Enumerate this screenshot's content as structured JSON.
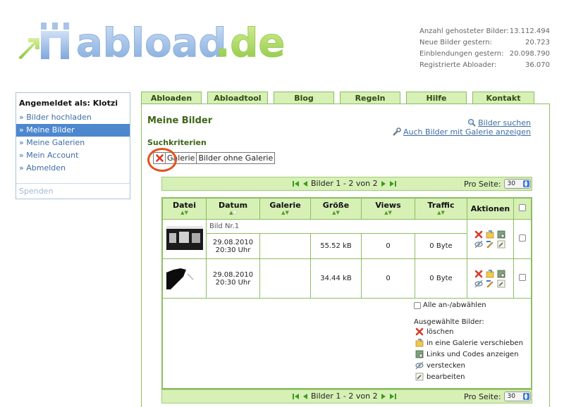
{
  "logo": {
    "text": "abload.de"
  },
  "stats": [
    {
      "label": "Anzahl gehosteter Bilder:",
      "value": "13.112.494"
    },
    {
      "label": "Neue Bilder gestern:",
      "value": "20.723"
    },
    {
      "label": "Einblendungen gestern:",
      "value": "20.098.790"
    },
    {
      "label": "Registrierte Abloader:",
      "value": "36.070"
    }
  ],
  "sidebar": {
    "title": "Angemeldet als: Klotzi",
    "items": [
      {
        "label": "» Bilder hochladen"
      },
      {
        "label": "» Meine Bilder"
      },
      {
        "label": "» Meine Galerien"
      },
      {
        "label": "» Mein Account"
      },
      {
        "label": "» Abmelden"
      }
    ],
    "spenden": "Spenden"
  },
  "tabs": [
    {
      "label": "Abloaden"
    },
    {
      "label": "Abloadtool"
    },
    {
      "label": "Blog"
    },
    {
      "label": "Regeln"
    },
    {
      "label": "Hilfe"
    },
    {
      "label": "Kontakt"
    }
  ],
  "page": {
    "title": "Meine Bilder",
    "search_link": "Bilder suchen",
    "gallery_link": "Auch Bilder mit Galerie anzeigen",
    "criteria_title": "Suchkriterien",
    "filter_chips": [
      "Galerie",
      "Bilder ohne Galerie"
    ]
  },
  "pager": {
    "text": "Bilder 1 - 2 von 2",
    "per_page_label": "Pro Seite:",
    "per_page_value": "30"
  },
  "table": {
    "headers": {
      "datei": "Datei",
      "datum": "Datum",
      "galerie": "Galerie",
      "groesse": "Größe",
      "views": "Views",
      "traffic": "Traffic",
      "aktionen": "Aktionen"
    },
    "rows": [
      {
        "name": "Bild Nr.1",
        "date": "29.08.2010",
        "time": "20:30 Uhr",
        "gallery": "",
        "size": "55.52 kB",
        "views": "0",
        "traffic": "0 Byte"
      },
      {
        "name": "",
        "date": "29.08.2010",
        "time": "20:30 Uhr",
        "gallery": "",
        "size": "34.44 kB",
        "views": "0",
        "traffic": "0 Byte"
      }
    ]
  },
  "bulk": {
    "select_all": "Alle an-/abwählen",
    "selected_title": "Ausgewählte Bilder:",
    "actions": [
      {
        "label": "löschen",
        "icon": "delete-icon"
      },
      {
        "label": "in eine Galerie verschieben",
        "icon": "folder-move-icon"
      },
      {
        "label": "Links und Codes anzeigen",
        "icon": "codes-icon"
      },
      {
        "label": "verstecken",
        "icon": "hide-icon"
      },
      {
        "label": "bearbeiten",
        "icon": "edit-icon"
      }
    ]
  },
  "colors": {
    "accent_green": "#d6f0b5",
    "border_green": "#8dbd62",
    "link_blue": "#3e6da1",
    "sidebar_active": "#4d88ce",
    "highlight_circle": "#e2531e"
  }
}
